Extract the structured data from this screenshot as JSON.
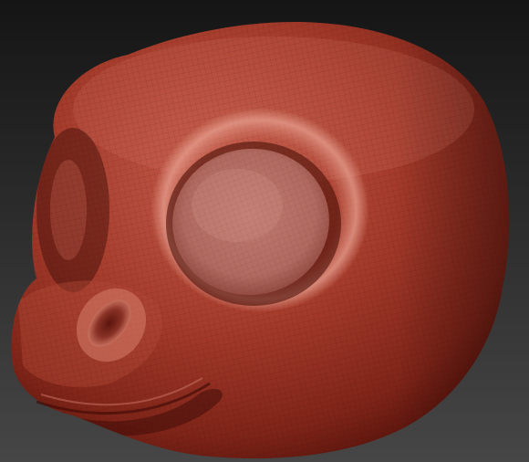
{
  "scene": {
    "subject": "sculpted-creature-head",
    "material_color": "#a0382a",
    "highlight_color": "#d07868",
    "shadow_color": "#3a0a06",
    "eye_socket_color": "#b86a5e",
    "background_top": "#151515",
    "background_bottom": "#464646",
    "wireframe_visible": true
  }
}
